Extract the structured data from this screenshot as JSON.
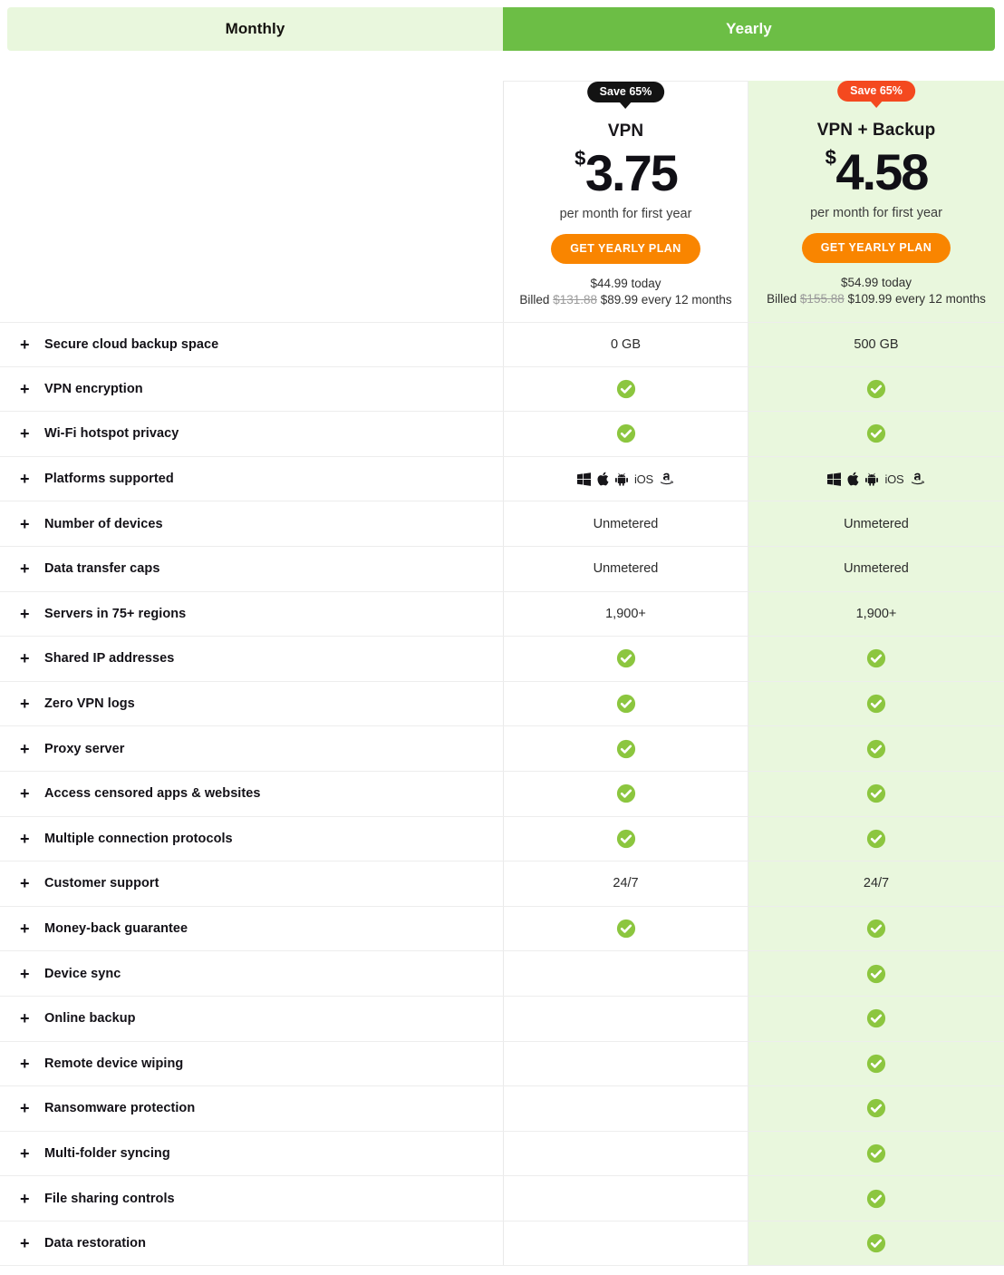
{
  "billing_tabs": [
    {
      "label": "Monthly",
      "active": false
    },
    {
      "label": "Yearly",
      "active": true
    }
  ],
  "colors": {
    "tab_active_bg": "#6cbe45",
    "tab_inactive_bg": "#e9f7dd",
    "highlight_column_bg": "#e9f7dd",
    "cta_orange": "#f98500",
    "badge_dark": "#131313",
    "badge_orange": "#f4491f",
    "check_green": "#8cc63f"
  },
  "plans": [
    {
      "id": "vpn",
      "badge": "Save 65%",
      "badge_style": "dark",
      "name": "VPN",
      "currency": "$",
      "price": "3.75",
      "price_note": "per month for first year",
      "cta_label": "GET YEARLY PLAN",
      "today_line": "$44.99 today",
      "billed_prefix": "Billed",
      "billed_was": "$131.88",
      "billed_now": "$89.99 every 12 months"
    },
    {
      "id": "vpn-backup",
      "badge": "Save 65%",
      "badge_style": "orange",
      "name": "VPN + Backup",
      "currency": "$",
      "price": "4.58",
      "price_note": "per month for first year",
      "cta_label": "GET YEARLY PLAN",
      "today_line": "$54.99 today",
      "billed_prefix": "Billed",
      "billed_was": "$155.88",
      "billed_now": "$109.99 every 12 months"
    }
  ],
  "expand_icon": "+",
  "features": [
    {
      "label": "Secure cloud backup space",
      "vpn": "0 GB",
      "backup": "500 GB"
    },
    {
      "label": "VPN encryption",
      "vpn": "check",
      "backup": "check"
    },
    {
      "label": "Wi-Fi hotspot privacy",
      "vpn": "check",
      "backup": "check"
    },
    {
      "label": "Platforms supported",
      "vpn": "platforms",
      "backup": "platforms"
    },
    {
      "label": "Number of devices",
      "vpn": "Unmetered",
      "backup": "Unmetered"
    },
    {
      "label": "Data transfer caps",
      "vpn": "Unmetered",
      "backup": "Unmetered"
    },
    {
      "label": "Servers in 75+ regions",
      "vpn": "1,900+",
      "backup": "1,900+"
    },
    {
      "label": "Shared IP addresses",
      "vpn": "check",
      "backup": "check"
    },
    {
      "label": "Zero VPN logs",
      "vpn": "check",
      "backup": "check"
    },
    {
      "label": "Proxy server",
      "vpn": "check",
      "backup": "check"
    },
    {
      "label": "Access censored apps & websites",
      "vpn": "check",
      "backup": "check"
    },
    {
      "label": "Multiple connection protocols",
      "vpn": "check",
      "backup": "check"
    },
    {
      "label": "Customer support",
      "vpn": "24/7",
      "backup": "24/7"
    },
    {
      "label": "Money-back guarantee",
      "vpn": "check",
      "backup": "check"
    },
    {
      "label": "Device sync",
      "vpn": "",
      "backup": "check"
    },
    {
      "label": "Online backup",
      "vpn": "",
      "backup": "check"
    },
    {
      "label": "Remote device wiping",
      "vpn": "",
      "backup": "check"
    },
    {
      "label": "Ransomware protection",
      "vpn": "",
      "backup": "check"
    },
    {
      "label": "Multi-folder syncing",
      "vpn": "",
      "backup": "check"
    },
    {
      "label": "File sharing controls",
      "vpn": "",
      "backup": "check"
    },
    {
      "label": "Data restoration",
      "vpn": "",
      "backup": "check"
    }
  ],
  "platform_icons": [
    "windows-icon",
    "apple-icon",
    "android-icon",
    "ios-label",
    "amazon-icon"
  ],
  "platform_ios_label": "iOS"
}
